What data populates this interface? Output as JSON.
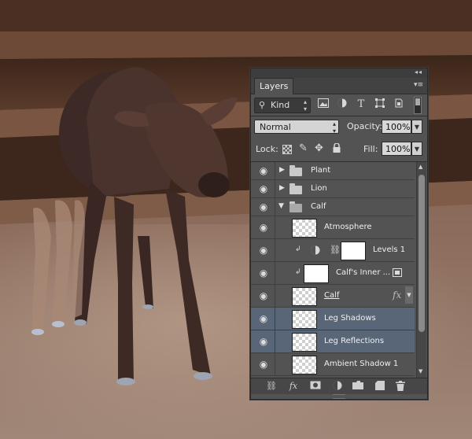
{
  "panel": {
    "tab_label": "Layers",
    "collapse_glyph": "◂◂",
    "close_glyph": "✕",
    "menu_glyph": "▾≡"
  },
  "filter": {
    "search_glyph": "⚲",
    "kind_label": "Kind",
    "icons": [
      "image-filter-icon",
      "adjustment-filter-icon",
      "type-filter-icon",
      "shape-filter-icon",
      "smart-object-filter-icon"
    ]
  },
  "blend": {
    "mode": "Normal",
    "opacity_label": "Opacity:",
    "opacity_value": "100%",
    "lock_label": "Lock:",
    "fill_label": "Fill:",
    "fill_value": "100%"
  },
  "layers": [
    {
      "name": "Plant",
      "type": "group",
      "expanded": false
    },
    {
      "name": "Lion",
      "type": "group",
      "expanded": false
    },
    {
      "name": "Calf",
      "type": "group",
      "expanded": true
    },
    {
      "name": "Atmosphere",
      "type": "layer"
    },
    {
      "name": "Levels 1",
      "type": "adjustment"
    },
    {
      "name": "Calf's Inner ...",
      "type": "clipped"
    },
    {
      "name": "Calf",
      "type": "layer",
      "fx": "fx"
    },
    {
      "name": "Leg Shadows",
      "type": "layer",
      "selected": true
    },
    {
      "name": "Leg Reflections",
      "type": "layer",
      "selected": true
    },
    {
      "name": "Ambient Shadow 1",
      "type": "layer"
    }
  ],
  "bottom_icons": [
    "link-layers-icon",
    "fx-icon",
    "mask-icon",
    "adjustment-icon",
    "new-group-icon",
    "new-layer-icon",
    "trash-icon"
  ],
  "colors": {
    "panel_bg": "#535353",
    "selected_row": "#596678"
  }
}
